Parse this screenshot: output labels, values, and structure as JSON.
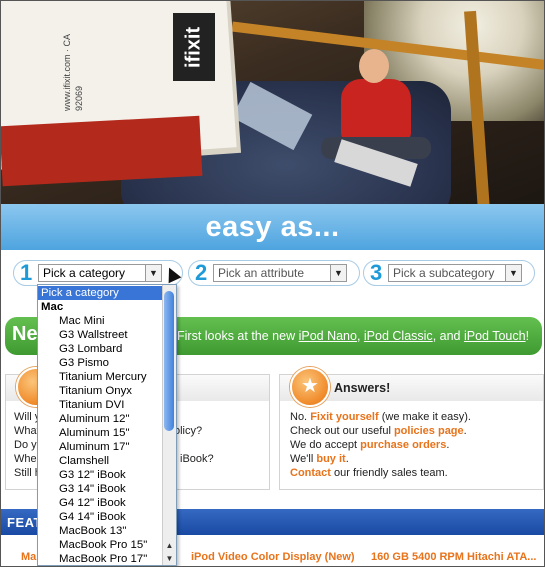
{
  "hero": {
    "logo_text": "ifixit",
    "book_text": "www.ifixit.com · CA 92069"
  },
  "banner": {
    "title": "easy as..."
  },
  "steps": [
    {
      "number": "1",
      "value": "Pick a category"
    },
    {
      "number": "2",
      "value": "Pick an attribute"
    },
    {
      "number": "3",
      "value": "Pick a subcategory"
    }
  ],
  "dropdown": {
    "options": [
      {
        "label": "Pick a category",
        "kind": "selected"
      },
      {
        "label": "Mac",
        "kind": "group"
      },
      {
        "label": "Mac Mini",
        "kind": "item"
      },
      {
        "label": "G3 Wallstreet",
        "kind": "item"
      },
      {
        "label": "G3 Lombard",
        "kind": "item"
      },
      {
        "label": "G3 Pismo",
        "kind": "item"
      },
      {
        "label": "Titanium Mercury",
        "kind": "item"
      },
      {
        "label": "Titanium Onyx",
        "kind": "item"
      },
      {
        "label": "Titanium DVI",
        "kind": "item"
      },
      {
        "label": "Aluminum 12\"",
        "kind": "item"
      },
      {
        "label": "Aluminum 15\"",
        "kind": "item"
      },
      {
        "label": "Aluminum 17\"",
        "kind": "item"
      },
      {
        "label": "Clamshell",
        "kind": "item"
      },
      {
        "label": "G3 12\" iBook",
        "kind": "item"
      },
      {
        "label": "G3 14\" iBook",
        "kind": "item"
      },
      {
        "label": "G4 12\" iBook",
        "kind": "item"
      },
      {
        "label": "G4 14\" iBook",
        "kind": "item"
      },
      {
        "label": "MacBook 13\"",
        "kind": "item"
      },
      {
        "label": "MacBook Pro 15\"",
        "kind": "item"
      },
      {
        "label": "MacBook Pro 17\"",
        "kind": "item"
      }
    ]
  },
  "news": {
    "lead": "Ne",
    "text_before": "First looks at the new ",
    "link1": "iPod Nano",
    "sep1": ", ",
    "link2": "iPod Classic",
    "sep2": ", and ",
    "link3": "iPod Touch",
    "end": "!"
  },
  "left_box": {
    "lines": [
      "Will yo",
      "What's",
      "Do yo",
      "Wher",
      "Still h"
    ],
    "fragments": [
      "olicy?",
      "iBook?"
    ]
  },
  "answers": {
    "title": "Answers!",
    "line1_a": "No. ",
    "line1_link": "Fixit yourself",
    "line1_b": " (we make it easy).",
    "line2_a": "Check out our useful ",
    "line2_link": "policies page",
    "line2_b": ".",
    "line3_a": "We do accept ",
    "line3_link": "purchase orders",
    "line3_b": ".",
    "line4_a": "We'll ",
    "line4_link": "buy it",
    "line4_b": ".",
    "line5_link": "Contact",
    "line5_b": " our friendly sales team."
  },
  "featured": {
    "title": "FEATU",
    "products": [
      "Ma",
      "iPod Video Color Display (New)",
      "160 GB 5400 RPM Hitachi ATA..."
    ]
  },
  "colors": {
    "accent_blue": "#1f9ad8",
    "accent_orange": "#e8731b",
    "news_green": "#4caf3b",
    "featured_blue": "#1f4fa8"
  }
}
